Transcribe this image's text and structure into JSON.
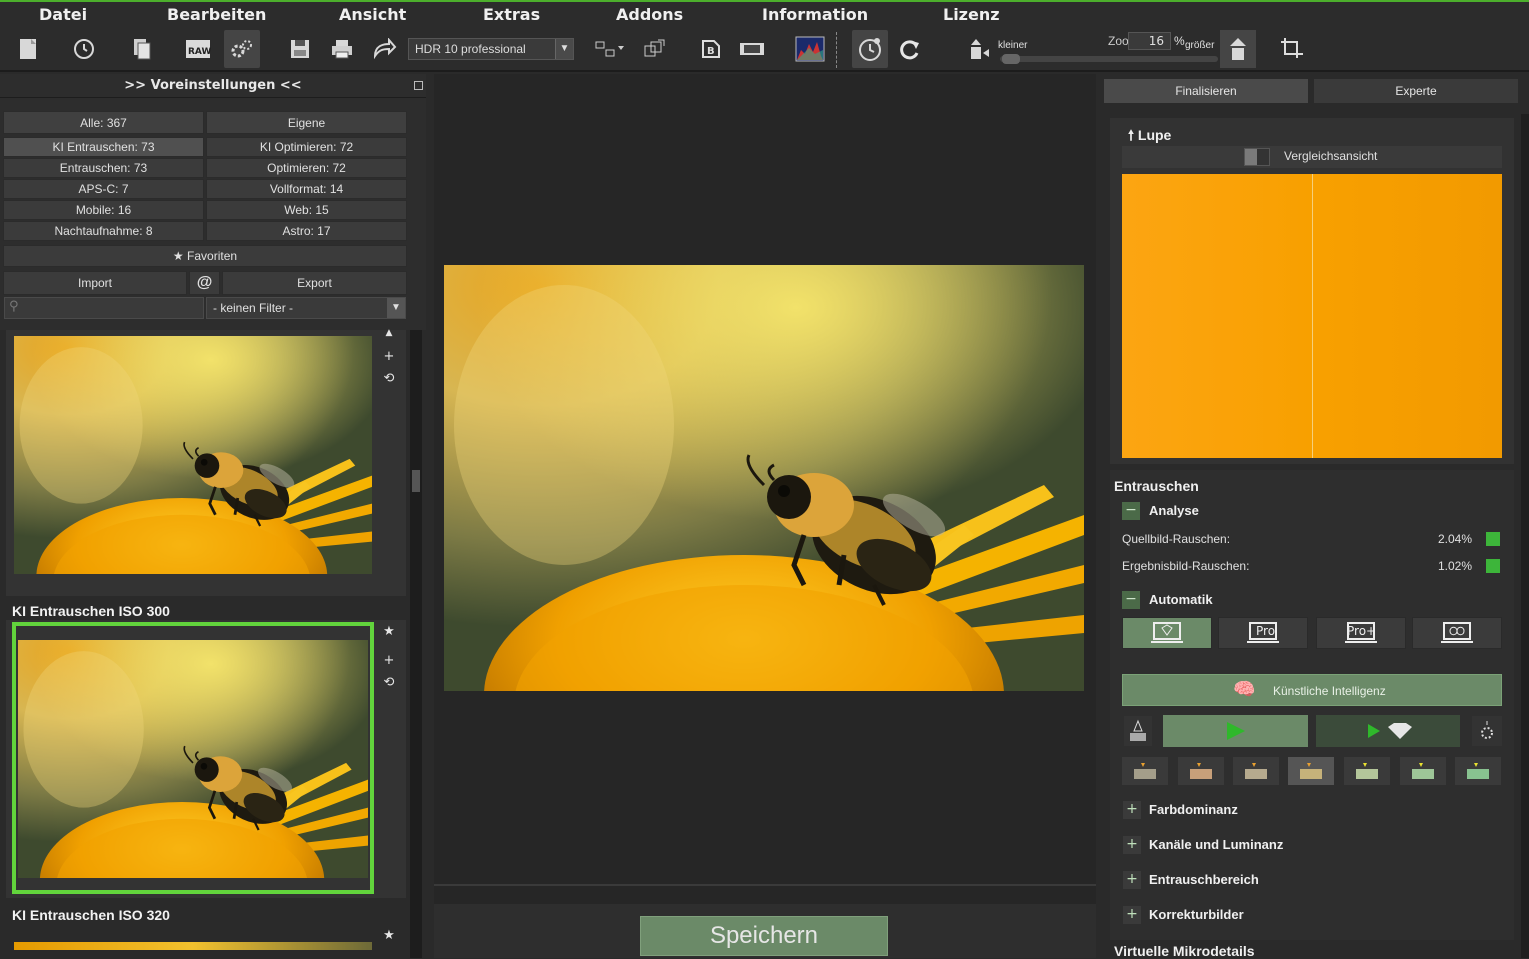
{
  "menu": [
    "Datei",
    "Bearbeiten",
    "Ansicht",
    "Extras",
    "Addons",
    "Information",
    "Lizenz"
  ],
  "toolbar": {
    "profile": "HDR 10 professional",
    "zoom_label": "Zoom",
    "zoom_value": "16",
    "zoom_unit": "%",
    "smaller_label": "kleiner",
    "larger_label": "größer"
  },
  "left": {
    "title": ">> Voreinstellungen <<",
    "tabs": [
      "Alle: 367",
      "Eigene"
    ],
    "categories": [
      [
        "KI Entrauschen: 73",
        "KI Optimieren: 72"
      ],
      [
        "Entrauschen: 73",
        "Optimieren: 72"
      ],
      [
        "APS-C: 7",
        "Vollformat: 14"
      ],
      [
        "Mobile: 16",
        "Web: 15"
      ],
      [
        "Nachtaufnahme: 8",
        "Astro: 17"
      ]
    ],
    "favorites": "Favoriten",
    "import": "Import",
    "at": "@",
    "export": "Export",
    "filter": "- keinen Filter -",
    "presets": [
      "KI Entrauschen ISO 300",
      "KI Entrauschen ISO 320"
    ]
  },
  "center": {
    "save": "Speichern"
  },
  "right": {
    "tabs": [
      "Finalisieren",
      "Experte"
    ],
    "loupe_title": "Lupe",
    "compare": "Vergleichsansicht",
    "denoise_title": "Entrauschen",
    "analysis": "Analyse",
    "source_noise_label": "Quellbild-Rauschen:",
    "source_noise_value": "2.04%",
    "result_noise_label": "Ergebnisbild-Rauschen:",
    "result_noise_value": "1.02%",
    "auto": "Automatik",
    "modes": [
      "",
      "Pro",
      "Pro+",
      ""
    ],
    "ai": "Künstliche Intelligenz",
    "collapsed_sections": [
      "Farbdominanz",
      "Kanäle und Luminanz",
      "Entrauschbereich",
      "Korrekturbilder"
    ],
    "next_section": "Virtuelle Mikrodetails"
  }
}
